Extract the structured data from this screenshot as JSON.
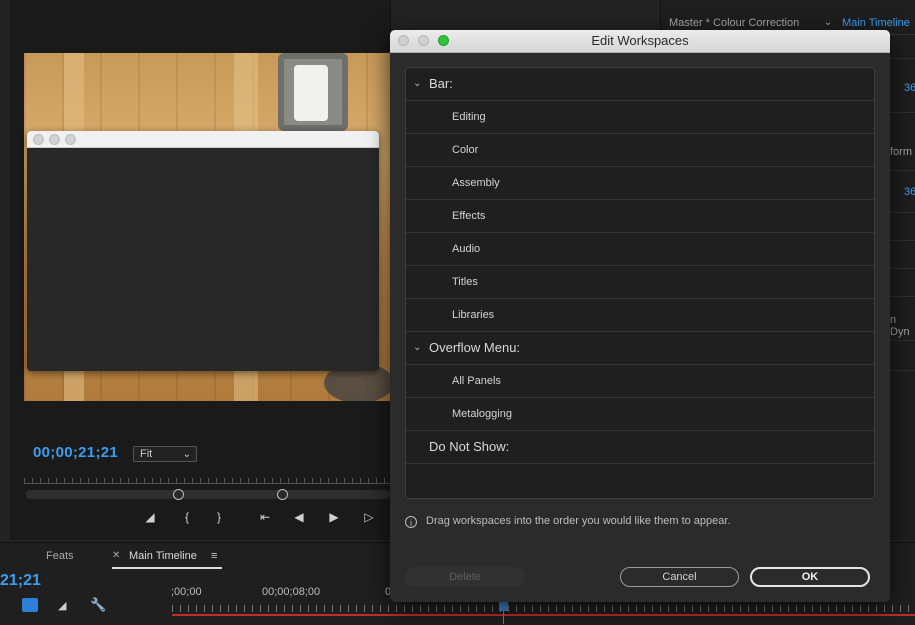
{
  "dialog": {
    "title": "Edit Workspaces",
    "sections": [
      {
        "label": "Bar:",
        "items": [
          "Editing",
          "Color",
          "Assembly",
          "Effects",
          "Audio",
          "Titles",
          "Libraries"
        ]
      },
      {
        "label": "Overflow Menu:",
        "items": [
          "All Panels",
          "Metalogging"
        ]
      },
      {
        "label": "Do Not Show:",
        "items": []
      }
    ],
    "hint": "Drag workspaces into the order you would like them to appear.",
    "delete_label": "Delete",
    "cancel_label": "Cancel",
    "ok_label": "OK",
    "max_dot_color": "#30c23d"
  },
  "program_monitor": {
    "timecode": "00;00;21;21",
    "fit_value": "Fit"
  },
  "timeline": {
    "tabs": [
      "Feats",
      "Main Timeline"
    ],
    "timecode": "21;21",
    "ruler_labels": [
      ";00;00",
      "00;00;08;00",
      "0"
    ]
  },
  "right_panel": {
    "tab1": "Master * Colour Correction",
    "tab2": "Main Timeline",
    "values": [
      "36",
      "36"
    ],
    "texts": [
      "form",
      "n Dyn"
    ]
  },
  "icons": {
    "chevron": "chevron-down-icon",
    "info": "info-icon"
  },
  "accent_color": "#3d9ef0"
}
